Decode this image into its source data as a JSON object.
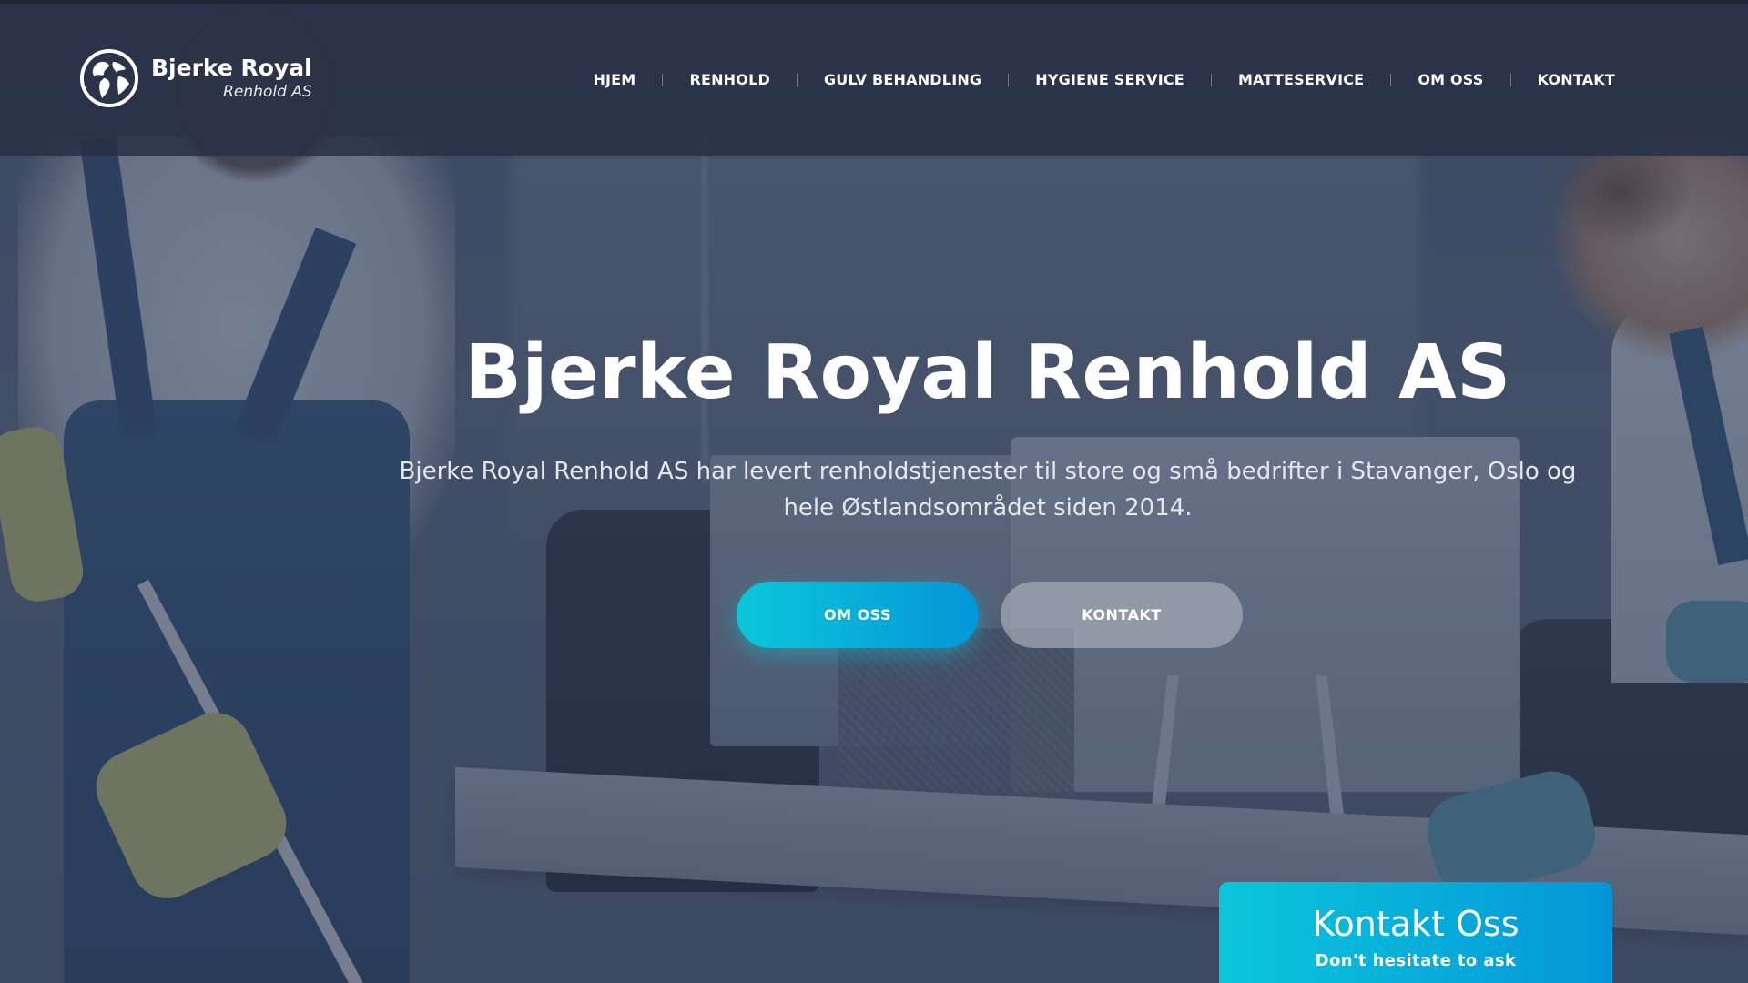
{
  "brand": {
    "name": "Bjerke Royal",
    "tagline": "Renhold AS",
    "logo_icon": "globe-icon"
  },
  "nav": {
    "items": [
      {
        "label": "HJEM"
      },
      {
        "label": "RENHOLD"
      },
      {
        "label": "GULV BEHANDLING"
      },
      {
        "label": "HYGIENE SERVICE"
      },
      {
        "label": "MATTESERVICE"
      },
      {
        "label": "OM OSS"
      },
      {
        "label": "KONTAKT"
      }
    ]
  },
  "hero": {
    "title": "Bjerke Royal Renhold AS",
    "text": "Bjerke Royal Renhold AS har levert renholdstjenester til store og små bedrifter i Stavanger, Oslo og hele Østlandsområdet siden 2014.",
    "primary_button": "OM OSS",
    "secondary_button": "KONTAKT"
  },
  "contact_card": {
    "title": "Kontakt Oss",
    "subtitle": "Don't hesitate to ask"
  },
  "colors": {
    "accent_start": "#0bc6da",
    "accent_end": "#0496d8",
    "header_bg": "#283146",
    "text": "#ffffff"
  }
}
